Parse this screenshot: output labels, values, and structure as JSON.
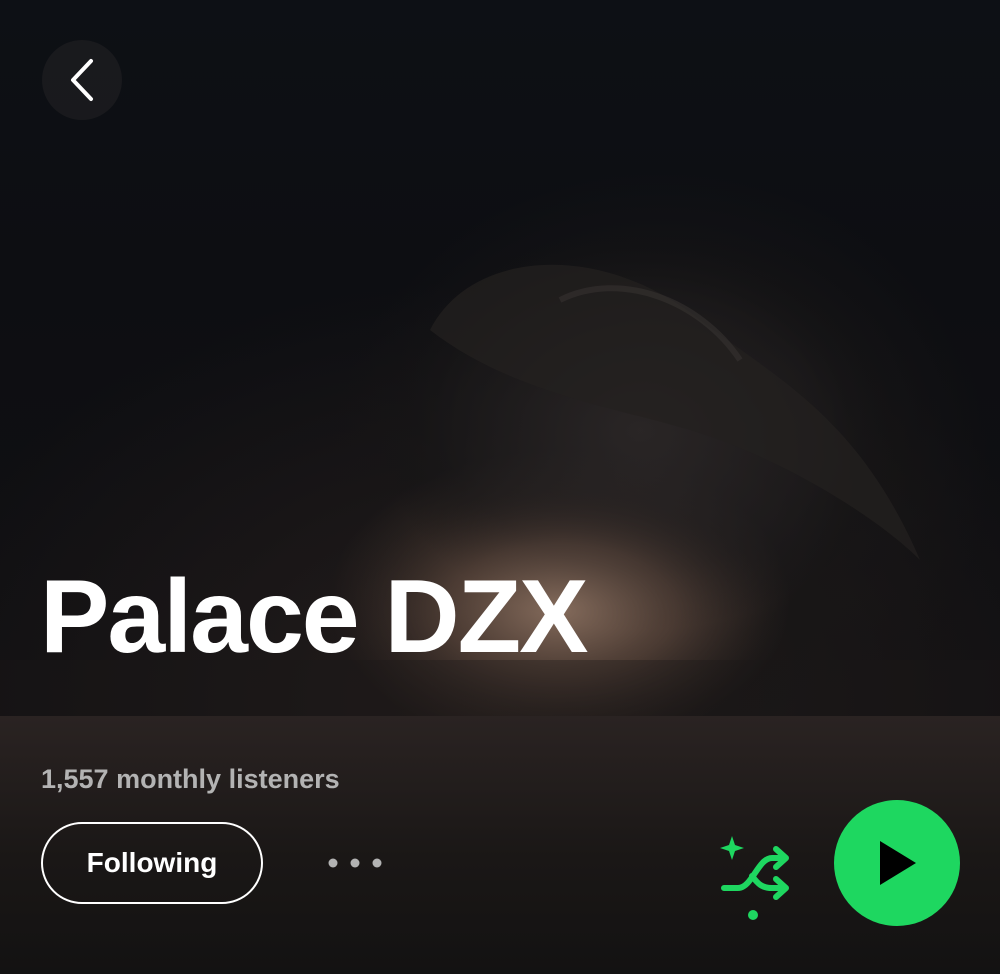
{
  "artist": {
    "name": "Palace DZX",
    "monthly_listeners": "1,557 monthly listeners"
  },
  "actions": {
    "follow_label": "Following"
  },
  "icons": {
    "back": "chevron-left-icon",
    "more": "more-horizontal-icon",
    "shuffle": "smart-shuffle-icon",
    "play": "play-icon"
  },
  "colors": {
    "accent": "#1ed760",
    "text_primary": "#ffffff",
    "text_secondary": "#b3b3b3"
  }
}
